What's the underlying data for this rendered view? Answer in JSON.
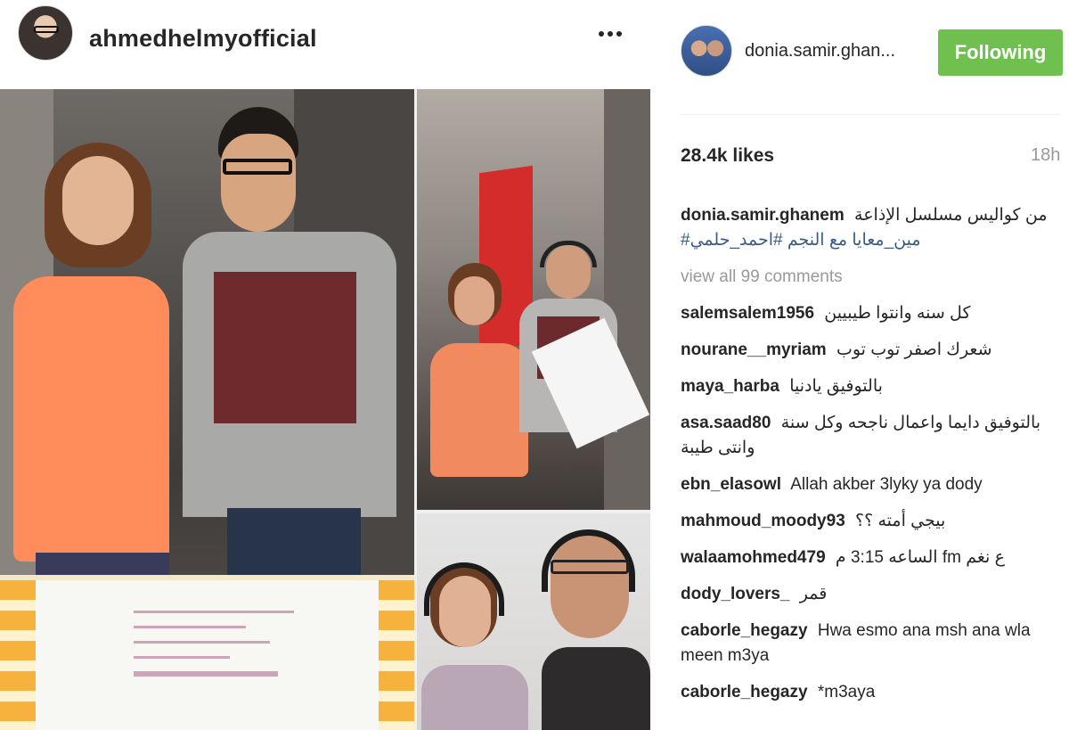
{
  "post": {
    "owner_username": "ahmedhelmyofficial",
    "poster_username": "donia.samir.ghan...",
    "follow_label": "Following",
    "likes": "28.4k likes",
    "time": "18h",
    "caption_user": "donia.samir.ghanem",
    "caption_text": "من كواليس مسلسل الإذاعة",
    "caption_tags": "#مين_معايا مع النجم #احمد_حلمي",
    "view_all": "view all 99 comments"
  },
  "comments": [
    {
      "user": "salemsalem1956",
      "text": "كل سنه وانتوا طيبيين"
    },
    {
      "user": "nourane__myriam",
      "text": "شعرك اصفر توب توب"
    },
    {
      "user": "maya_harba",
      "text": "بالتوفيق يادنيا"
    },
    {
      "user": "asa.saad80",
      "text": "بالتوفيق دايما واعمال ناجحه وكل سنة وانتى طيبة"
    },
    {
      "user": "ebn_elasowl",
      "text": "Allah akber 3lyky ya dody"
    },
    {
      "user": "mahmoud_moody93",
      "text": "بيجي أمته ؟؟"
    },
    {
      "user": "walaamohmed479",
      "text": "الساعه 3:15 م fm ع نغم"
    },
    {
      "user": "dody_lovers_",
      "text": "قمر"
    },
    {
      "user": "caborle_hegazy",
      "text": "Hwa esmo ana msh ana wla meen m3ya"
    },
    {
      "user": "caborle_hegazy",
      "text": "*m3aya"
    }
  ],
  "colors": {
    "follow_button": "#70c050",
    "hashtag": "#3b5b87",
    "muted": "#999999"
  },
  "icons": {
    "more": "more-options-icon"
  }
}
